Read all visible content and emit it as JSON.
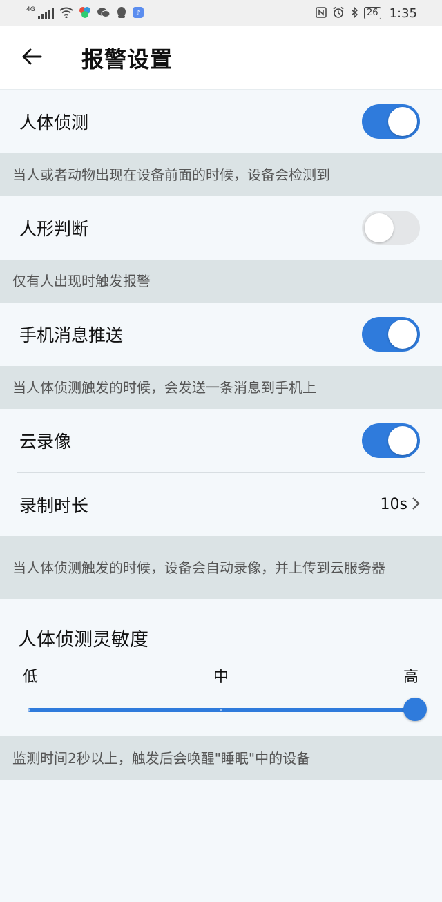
{
  "status_bar": {
    "network": "4G",
    "battery": "26",
    "time": "1:35"
  },
  "header": {
    "title": "报警设置"
  },
  "settings": {
    "human_detection": {
      "label": "人体侦测",
      "on": true,
      "desc": "当人或者动物出现在设备前面的时候，设备会检测到"
    },
    "human_shape": {
      "label": "人形判断",
      "on": false,
      "desc": "仅有人出现时触发报警"
    },
    "push": {
      "label": "手机消息推送",
      "on": true,
      "desc": "当人体侦测触发的时候，会发送一条消息到手机上"
    },
    "cloud": {
      "label": "云录像",
      "on": true
    },
    "record_duration": {
      "label": "录制时长",
      "value": "10s"
    },
    "cloud_desc": "当人体侦测触发的时候，设备会自动录像，并上传到云服务器"
  },
  "sensitivity": {
    "title": "人体侦测灵敏度",
    "low": "低",
    "mid": "中",
    "high": "高",
    "level": 1.0,
    "desc": "监测时间2秒以上，触发后会唤醒\"睡眠\"中的设备"
  },
  "colors": {
    "accent": "#2f7bdc",
    "desc_bg": "#dbe3e5",
    "page_bg": "#f4f8fb"
  }
}
